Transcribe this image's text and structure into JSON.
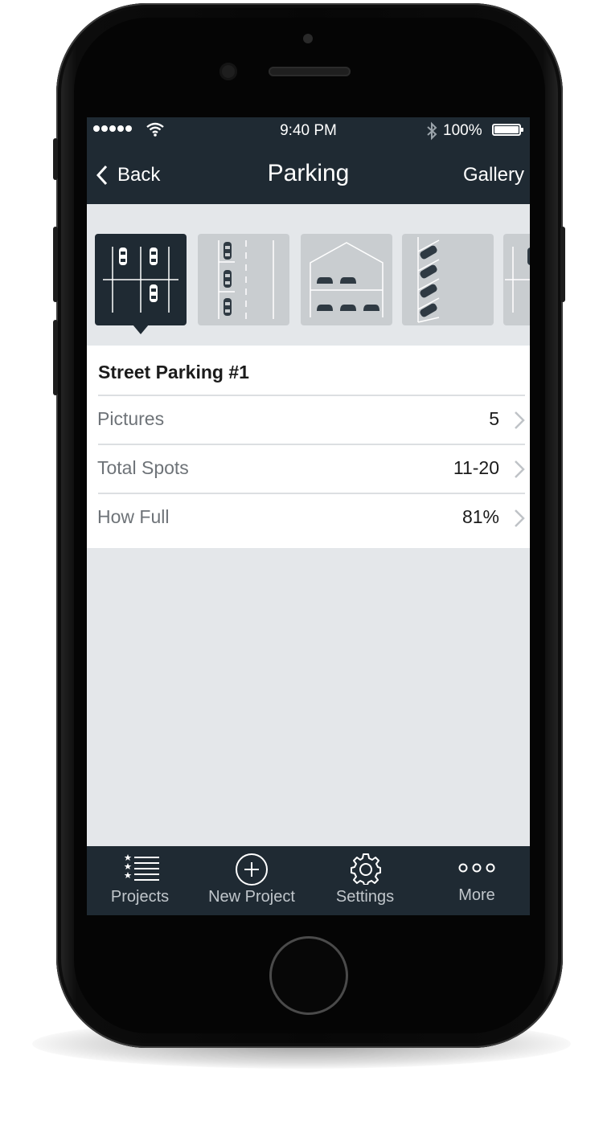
{
  "status_bar": {
    "time": "9:40 PM",
    "battery": "100%"
  },
  "nav": {
    "back_label": "Back",
    "title": "Parking",
    "gallery_label": "Gallery"
  },
  "carousel": {
    "tiles": [
      {
        "name": "street-parking-grid-icon",
        "selected": true
      },
      {
        "name": "parallel-parking-icon",
        "selected": false
      },
      {
        "name": "parking-garage-icon",
        "selected": false
      },
      {
        "name": "angled-parking-icon",
        "selected": false
      },
      {
        "name": "partial-parking-tile-icon",
        "selected": false
      }
    ]
  },
  "detail": {
    "title": "Street Parking #1",
    "rows": [
      {
        "label": "Pictures",
        "value": "5"
      },
      {
        "label": "Total Spots",
        "value": "11-20"
      },
      {
        "label": "How Full",
        "value": "81%"
      }
    ]
  },
  "tabbar": {
    "tabs": [
      {
        "label": "Projects",
        "icon": "starred-list-icon"
      },
      {
        "label": "New Project",
        "icon": "plus-circle-icon"
      },
      {
        "label": "Settings",
        "icon": "gear-icon"
      },
      {
        "label": "More",
        "icon": "more-dots-icon"
      }
    ]
  },
  "colors": {
    "dark_bar": "#1f2a33",
    "content_bg": "#e4e7ea",
    "tile_bg": "#c9cdd0"
  }
}
